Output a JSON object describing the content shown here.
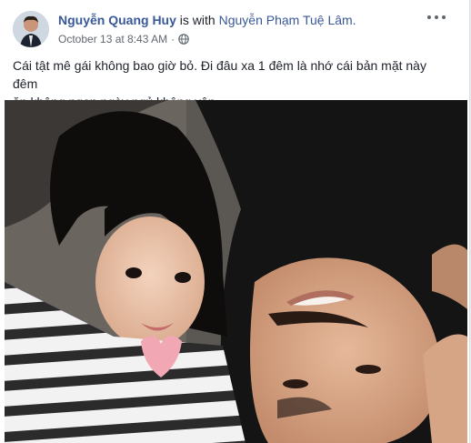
{
  "post": {
    "author": "Nguyễn Quang Huy",
    "with_text": "is with",
    "tagged": "Nguyễn Phạm Tuệ Lâm.",
    "timestamp": "October 13 at 8:43 AM",
    "separator": "·",
    "privacy_icon": "globe-icon",
    "text_line1": "Cái tật mê gái không bao giờ bỏ. Đi đâu xa 1 đêm là nhớ cái bản mặt này đêm",
    "text_line2": "ăn không ngon ngày ngủ không yên"
  },
  "colors": {
    "link": "#385898",
    "text": "#1d2129",
    "meta": "#616770"
  }
}
